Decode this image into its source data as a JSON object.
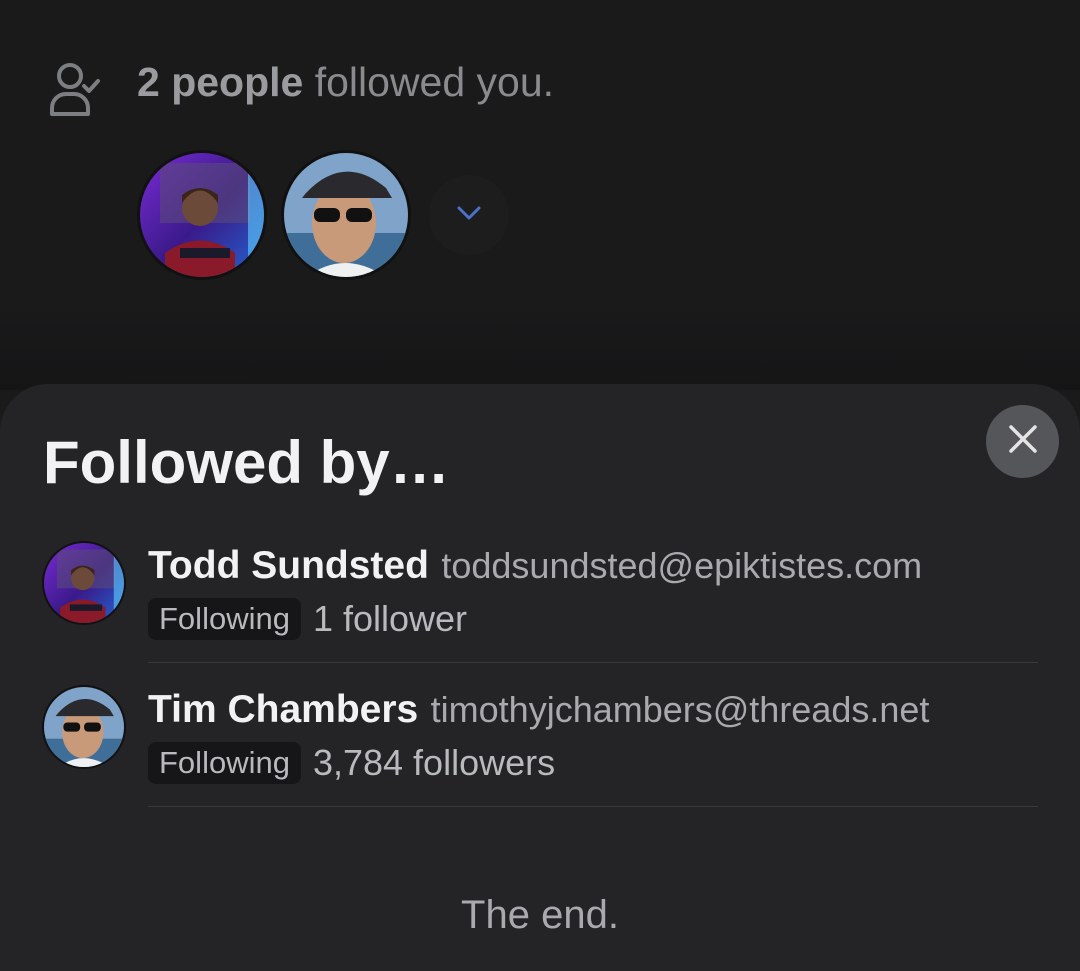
{
  "notification": {
    "icon": "person-check-icon",
    "count_text": "2 people",
    "rest_text": "followed you.",
    "expand_icon": "chevron-down-icon"
  },
  "sheet": {
    "title": "Followed by…",
    "close_icon": "close-icon",
    "followers": [
      {
        "name": "Todd Sundsted",
        "handle": "toddsundsted@epiktistes.com",
        "badge": "Following",
        "followers": "1 follower"
      },
      {
        "name": "Tim Chambers",
        "handle": "timothyjchambers@threads.net",
        "badge": "Following",
        "followers": "3,784 followers"
      }
    ],
    "end_text": "The end."
  },
  "colors": {
    "background": "#1a1a1b",
    "sheet": "#242427",
    "accent": "#4a72c9"
  }
}
